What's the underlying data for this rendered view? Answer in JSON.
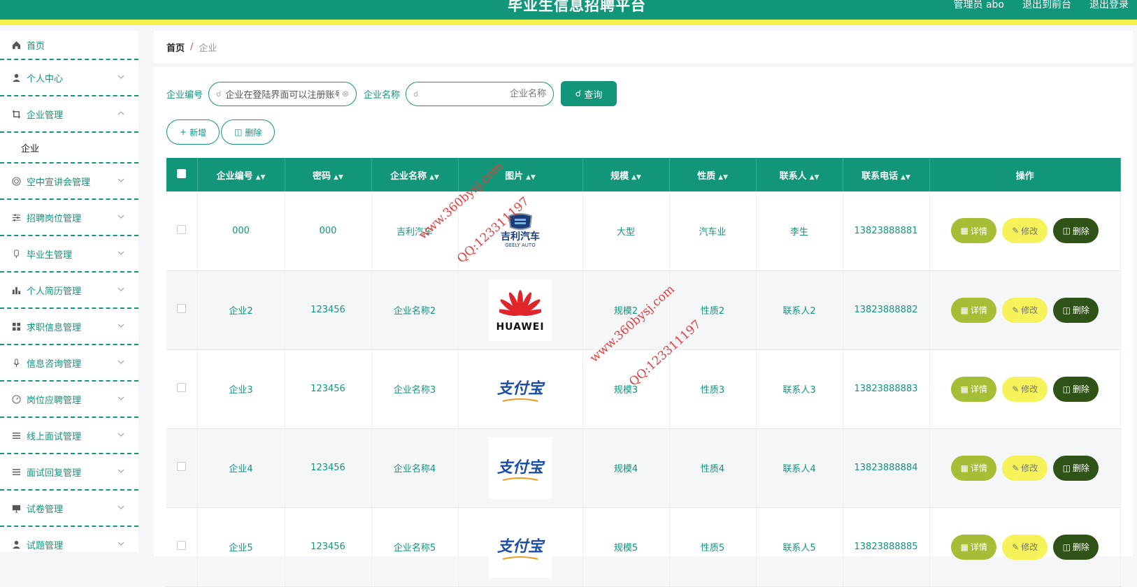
{
  "header": {
    "title": "毕业生信息招聘平台",
    "user": "管理员 abo",
    "exit_front": "退出到前台",
    "logout": "退出登录"
  },
  "sidebar": {
    "items": [
      {
        "label": "首页",
        "icon": "home-icon"
      },
      {
        "label": "个人中心",
        "icon": "user-icon"
      },
      {
        "label": "企业管理",
        "icon": "crop-icon"
      },
      {
        "label": "企业",
        "icon": ""
      },
      {
        "label": "空中宣讲会管理",
        "icon": "target-icon"
      },
      {
        "label": "招聘岗位管理",
        "icon": "sliders-icon"
      },
      {
        "label": "毕业生管理",
        "icon": "tag-icon"
      },
      {
        "label": "个人简历管理",
        "icon": "bar-chart-icon"
      },
      {
        "label": "求职信息管理",
        "icon": "grid-icon"
      },
      {
        "label": "信息咨询管理",
        "icon": "microphone-icon"
      },
      {
        "label": "岗位应聘管理",
        "icon": "gauge-icon"
      },
      {
        "label": "线上面试管理",
        "icon": "list-icon"
      },
      {
        "label": "面试回复管理",
        "icon": "list-icon"
      },
      {
        "label": "试卷管理",
        "icon": "monitor-icon"
      },
      {
        "label": "试题管理",
        "icon": "user-icon"
      }
    ]
  },
  "breadcrumb": {
    "home": "首页",
    "separator": "/",
    "current": "企业"
  },
  "search": {
    "label_no": "企业编号",
    "value_no": "企业在登陆界面可以注册账号",
    "label_name": "企业名称",
    "placeholder_name": "企业名称",
    "query": "查询"
  },
  "actions": {
    "add": "新增",
    "delete": "删除"
  },
  "table": {
    "headers": [
      "企业编号",
      "密码",
      "企业名称",
      "图片",
      "规模",
      "性质",
      "联系人",
      "联系电话",
      "操作"
    ],
    "rows": [
      {
        "no": "000",
        "pwd": "000",
        "name": "吉利汽车",
        "logo": "geely",
        "scale": "大型",
        "nature": "汽车业",
        "contact": "李生",
        "phone": "13823888881"
      },
      {
        "no": "企业2",
        "pwd": "123456",
        "name": "企业名称2",
        "logo": "huawei",
        "scale": "规模2",
        "nature": "性质2",
        "contact": "联系人2",
        "phone": "13823888882"
      },
      {
        "no": "企业3",
        "pwd": "123456",
        "name": "企业名称3",
        "logo": "alipay",
        "scale": "规模3",
        "nature": "性质3",
        "contact": "联系人3",
        "phone": "13823888883"
      },
      {
        "no": "企业4",
        "pwd": "123456",
        "name": "企业名称4",
        "logo": "alipay",
        "scale": "规模4",
        "nature": "性质4",
        "contact": "联系人4",
        "phone": "13823888884"
      },
      {
        "no": "企业5",
        "pwd": "123456",
        "name": "企业名称5",
        "logo": "alipay",
        "scale": "规模5",
        "nature": "性质5",
        "contact": "联系人5",
        "phone": "13823888885"
      }
    ],
    "ops": {
      "detail": "详情",
      "edit": "修改",
      "del": "删除"
    }
  },
  "logos": {
    "geely_cn": "吉利汽车",
    "geely_en": "GEELY AUTO",
    "huawei": "HUAWEI",
    "alipay": "支付宝"
  },
  "watermark": {
    "site": "www.360bysj.com",
    "qq": "QQ:123311197"
  },
  "colors": {
    "primary": "#12967a",
    "accent_bar": "#f3f24a",
    "detail": "#a4bf35",
    "edit": "#f6f25a",
    "delete": "#2f5316"
  }
}
